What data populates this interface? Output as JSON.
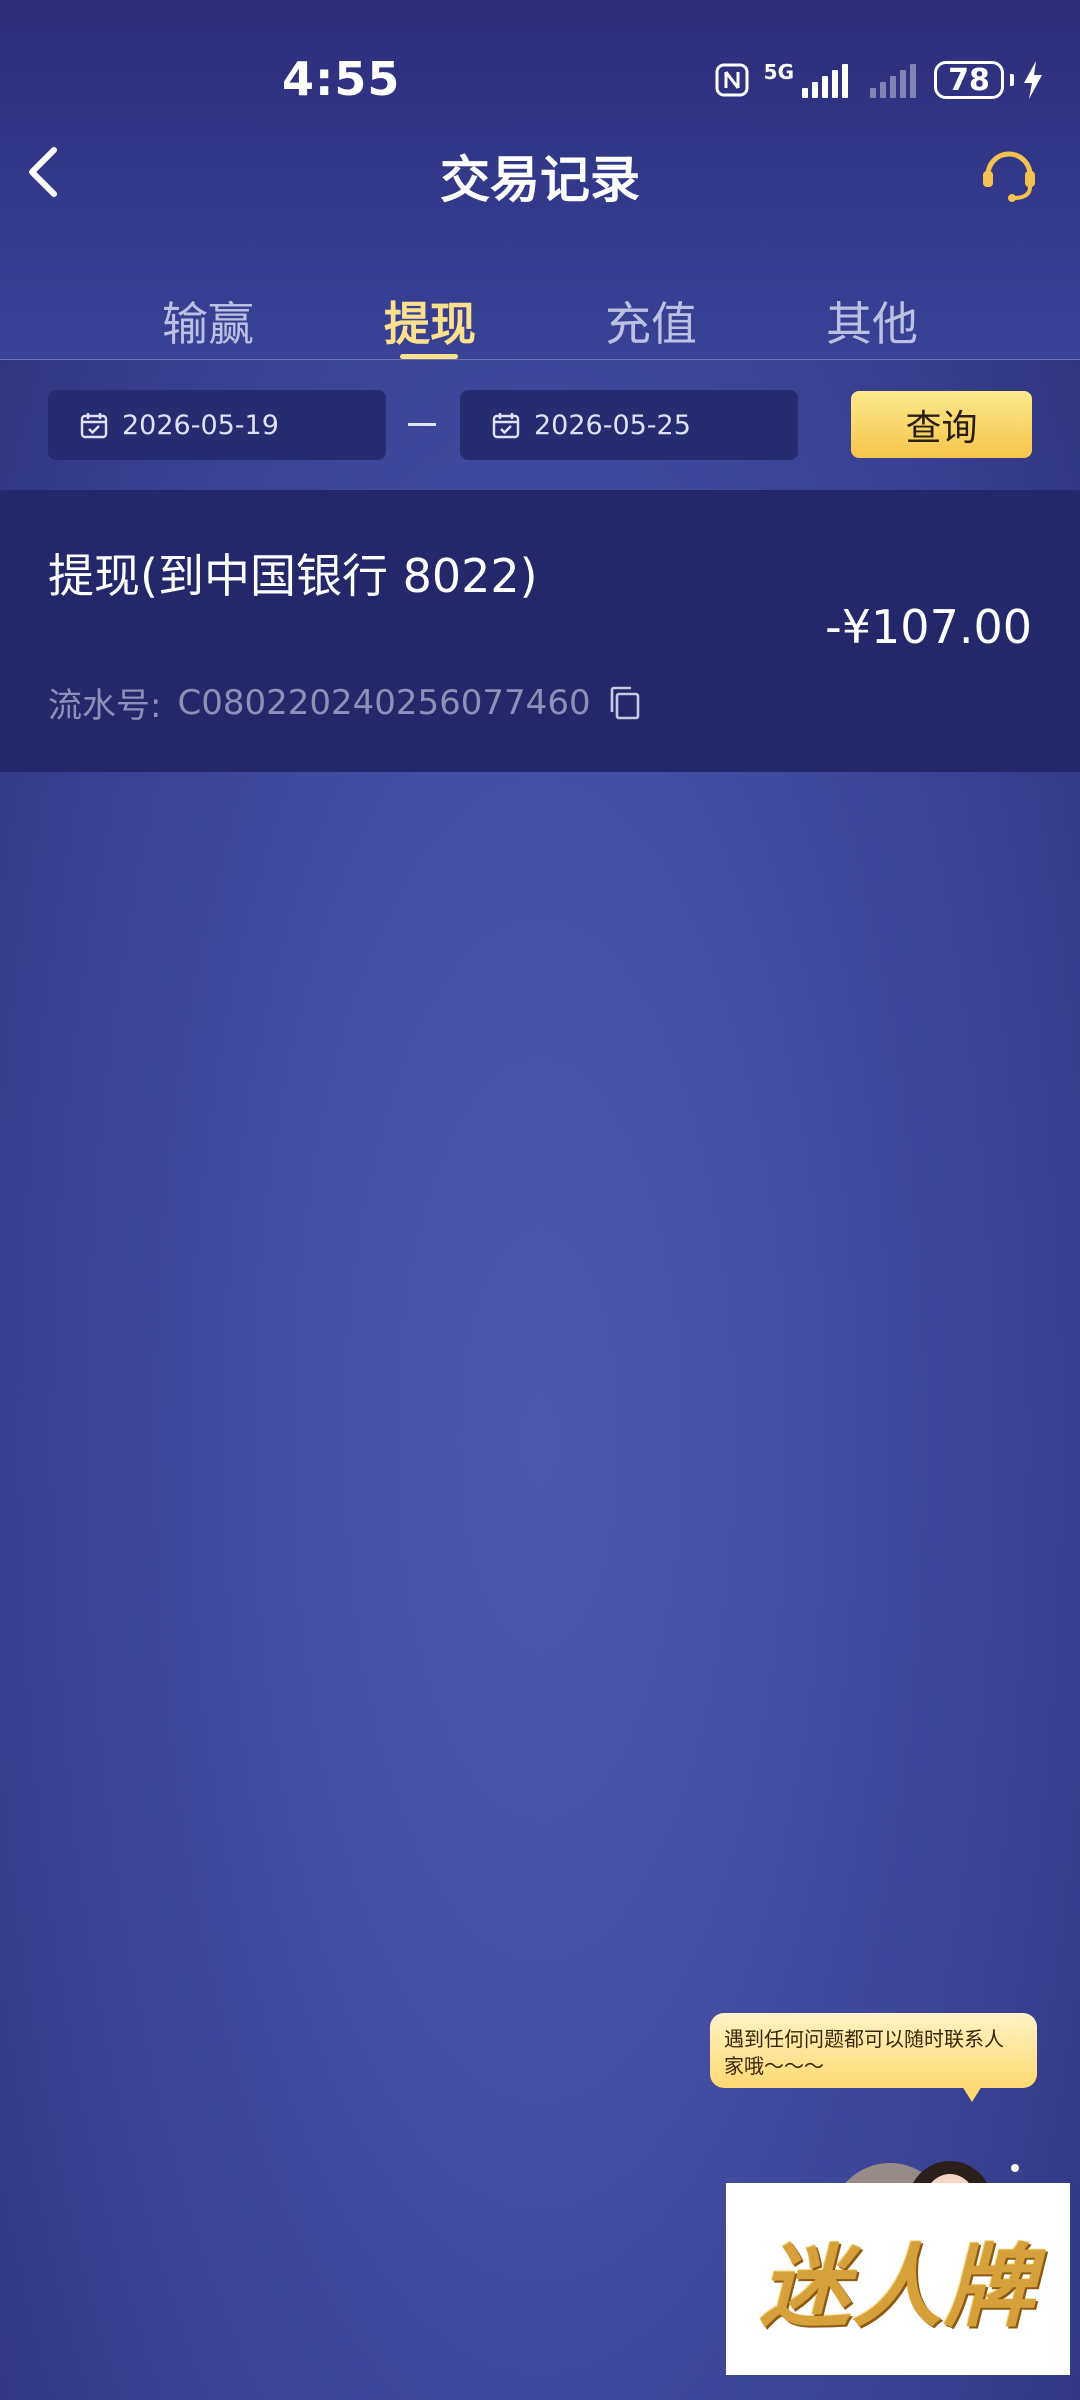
{
  "status_bar": {
    "time": "4:55",
    "network": "5G",
    "battery": "78"
  },
  "nav": {
    "title": "交易记录"
  },
  "tabs": [
    {
      "label": "输赢",
      "active": false
    },
    {
      "label": "提现",
      "active": true
    },
    {
      "label": "充值",
      "active": false
    },
    {
      "label": "其他",
      "active": false
    }
  ],
  "filter": {
    "start_date": "2026-05-19",
    "end_date": "2026-05-25",
    "separator": "—",
    "query_label": "查询"
  },
  "records": [
    {
      "title": "提现(到中国银行 8022)",
      "amount": "-¥107.00",
      "serial_label": "流水号:",
      "serial_value": "C080220240256077460"
    }
  ],
  "support": {
    "bubble_text": "遇到任何问题都可以随时联系人家哦～～～",
    "brand_text": "迷人牌"
  },
  "colors": {
    "accent": "#fbe08e",
    "query_button": "#f6c54b",
    "card_bg": "#24286a",
    "page_bg": "#454ea3"
  }
}
